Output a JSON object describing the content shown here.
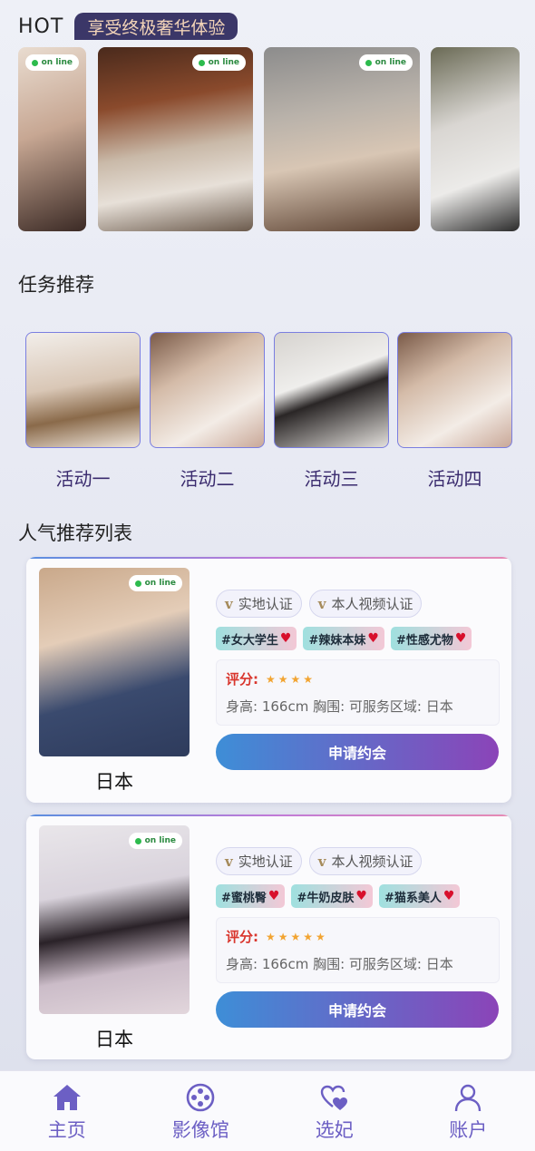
{
  "hot": {
    "label": "HOT",
    "banner": "享受终极奢华体验",
    "online_text": "on line"
  },
  "tasks": {
    "title": "任务推荐",
    "items": [
      {
        "label": "活动一"
      },
      {
        "label": "活动二"
      },
      {
        "label": "活动三"
      },
      {
        "label": "活动四"
      }
    ]
  },
  "popular": {
    "title": "人气推荐列表",
    "cards": [
      {
        "online_text": "on line",
        "name": "日本",
        "verify": [
          "实地认证",
          "本人视频认证"
        ],
        "verify_mark": "v",
        "tags": [
          "#女大学生",
          "#辣妹本妹",
          "#性感尤物"
        ],
        "score_label": "评分:",
        "stars": "★★★★",
        "star_count": 4,
        "detail": "身高: 166cm 胸围: 可服务区域: 日本",
        "button": "申请约会"
      },
      {
        "online_text": "on line",
        "name": "日本",
        "verify": [
          "实地认证",
          "本人视频认证"
        ],
        "verify_mark": "v",
        "tags": [
          "#蜜桃臀",
          "#牛奶皮肤",
          "#猫系美人"
        ],
        "score_label": "评分:",
        "stars": "★★★★★",
        "star_count": 5,
        "detail": "身高: 166cm 胸围: 可服务区域: 日本",
        "button": "申请约会"
      }
    ]
  },
  "nav": [
    {
      "label": "主页",
      "icon": "home-icon"
    },
    {
      "label": "影像馆",
      "icon": "film-reel-icon"
    },
    {
      "label": "选妃",
      "icon": "hearts-icon"
    },
    {
      "label": "账户",
      "icon": "user-icon"
    }
  ],
  "colors": {
    "accent": "#6c5fc4",
    "banner_bg": "#3b3768",
    "button_start": "#3e8ed7",
    "button_end": "#8b44b8"
  }
}
